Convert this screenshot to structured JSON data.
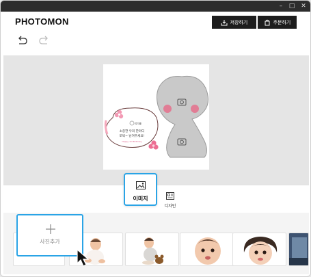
{
  "window": {
    "controls": [
      "–",
      "□",
      "✕"
    ]
  },
  "header": {
    "logo": "PHOTOMON",
    "save_label": "저장하기",
    "order_label": "주문하기"
  },
  "template": {
    "bubble_small": "여기를",
    "bubble_line1": "소중한 우리 한마디",
    "bubble_line2": "또박~ 남겨주세요!",
    "bubble_sub": "Happy 1st Birthday"
  },
  "tools": {
    "image_label": "이미지",
    "design_label": "디자인"
  },
  "tray": {
    "add_photo_label": "사진추가"
  },
  "colors": {
    "accent": "#2aa4e6",
    "dark_button": "#1d1d1d",
    "blush": "#f24b73"
  }
}
